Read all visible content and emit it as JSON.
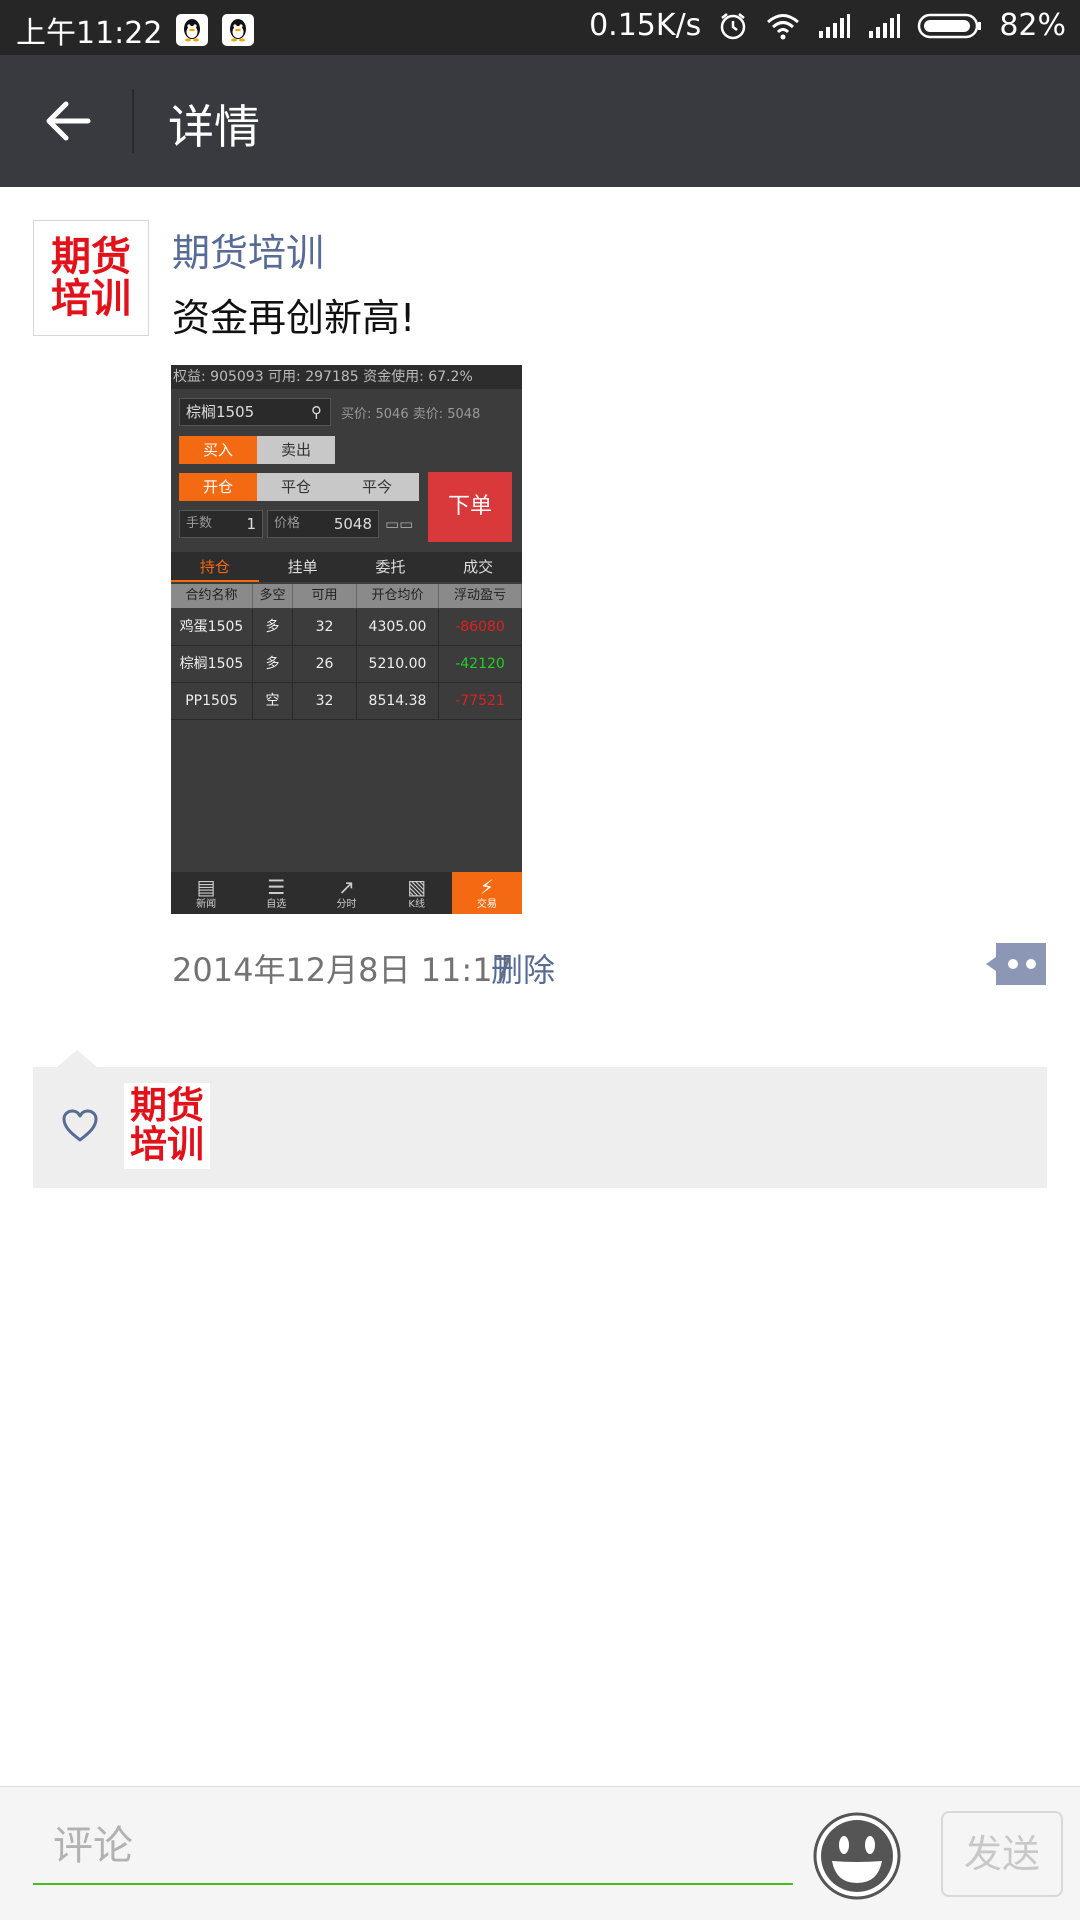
{
  "status_bar": {
    "time": "上午11:22",
    "net_speed": "0.15K/s",
    "battery": "82%",
    "icons": [
      "qq-icon",
      "qq-icon",
      "alarm-icon",
      "wifi-icon",
      "signal-icon",
      "signal-icon",
      "battery-icon"
    ]
  },
  "header": {
    "title": "详情",
    "back_icon": "arrow-left-icon"
  },
  "post": {
    "avatar_text": [
      "期货",
      "培训"
    ],
    "author": "期货培训",
    "text": "资金再创新高!",
    "time": "2014年12月8日 11:17",
    "delete_label": "删除",
    "more_icon": "comment-more-icon"
  },
  "screenshot": {
    "top_info": "权益: 905093 可用: 297185 资金使用: 67.2%",
    "contract": "棕榈1505",
    "quote": "买价: 5046 卖价: 5048",
    "buy": "买入",
    "sell": "卖出",
    "open": "开仓",
    "close": "平仓",
    "close_today": "平今",
    "order": "下单",
    "qty_label": "手数",
    "qty": "1",
    "price_label": "价格",
    "price": "5048",
    "tabs": [
      "持仓",
      "挂单",
      "委托",
      "成交"
    ],
    "columns": [
      "合约名称",
      "多空",
      "可用",
      "开仓均价",
      "浮动盈亏"
    ],
    "rows": [
      [
        "鸡蛋1505",
        "多",
        "32",
        "4305.00",
        "-86080"
      ],
      [
        "棕榈1505",
        "多",
        "26",
        "5210.00",
        "-42120"
      ],
      [
        "PP1505",
        "空",
        "32",
        "8514.38",
        "-77521"
      ]
    ],
    "nav": [
      "新闻",
      "自选",
      "分时",
      "K线",
      "交易"
    ]
  },
  "likes": {
    "heart_icon": "heart-outline-icon",
    "avatar_text": [
      "期货",
      "培训"
    ]
  },
  "comment_bar": {
    "placeholder": "评论",
    "send_label": "发送",
    "emoji_icon": "smiley-icon"
  }
}
